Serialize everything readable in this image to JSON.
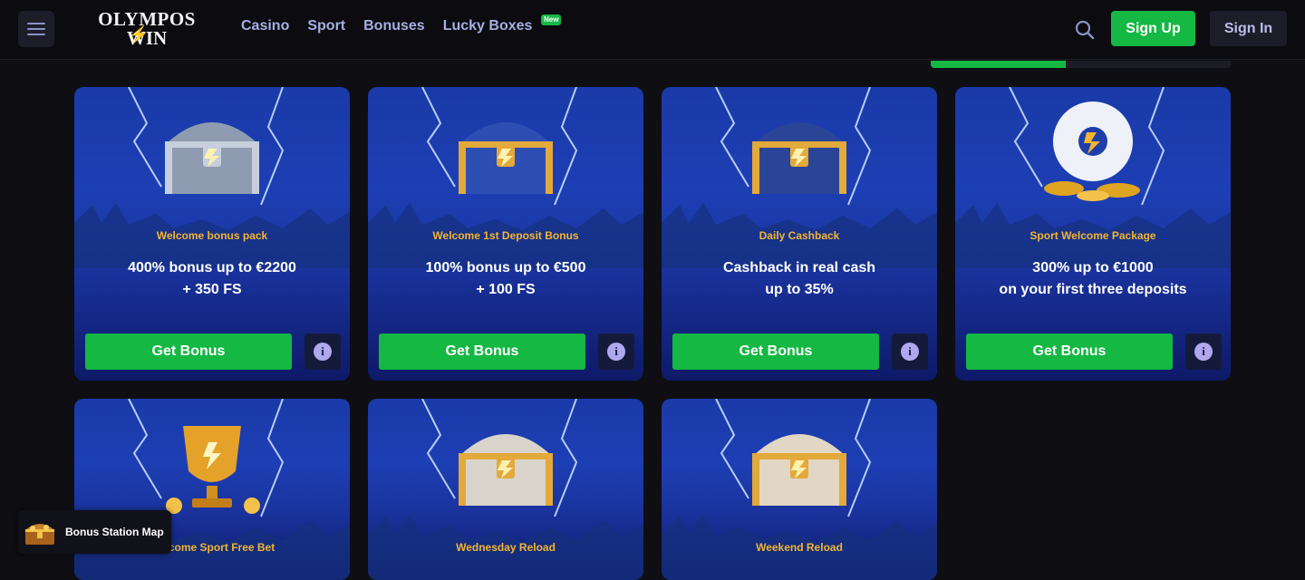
{
  "header": {
    "logo_line1": "OLYMPOS",
    "logo_line2": "WIN",
    "nav": [
      {
        "label": "Casino"
      },
      {
        "label": "Sport"
      },
      {
        "label": "Bonuses"
      },
      {
        "label": "Lucky Boxes",
        "badge": "New"
      }
    ],
    "signup_label": "Sign Up",
    "signin_label": "Sign In"
  },
  "progress": {
    "value": 0.45
  },
  "colors": {
    "accent_green": "#14b843",
    "label_gold": "#f3b530",
    "nav_text": "#a6afe3"
  },
  "cards": [
    {
      "label": "Welcome bonus pack",
      "title": "400% bonus up to €2200\n+ 350 FS",
      "button": "Get Bonus",
      "icon": "silver-chest-icon"
    },
    {
      "label": "Welcome 1st Deposit Bonus",
      "title": "100% bonus up to €500\n+ 100 FS",
      "button": "Get Bonus",
      "icon": "gold-chest-icon"
    },
    {
      "label": "Daily Cashback",
      "title": "Cashback in real cash\nup to 35%",
      "button": "Get Bonus",
      "icon": "vault-chest-icon"
    },
    {
      "label": "Sport Welcome Package",
      "title": "300% up to €1000\non your first three deposits",
      "button": "Get Bonus",
      "icon": "football-coins-icon"
    },
    {
      "label": "Welcome Sport Free Bet",
      "icon": "trophy-icon"
    },
    {
      "label": "Wednesday Reload",
      "icon": "stone-chest-icon"
    },
    {
      "label": "Weekend Reload",
      "icon": "crystal-chest-icon"
    }
  ],
  "map_widget": {
    "label": "Bonus Station Map",
    "icon": "treasure-chest-icon"
  }
}
